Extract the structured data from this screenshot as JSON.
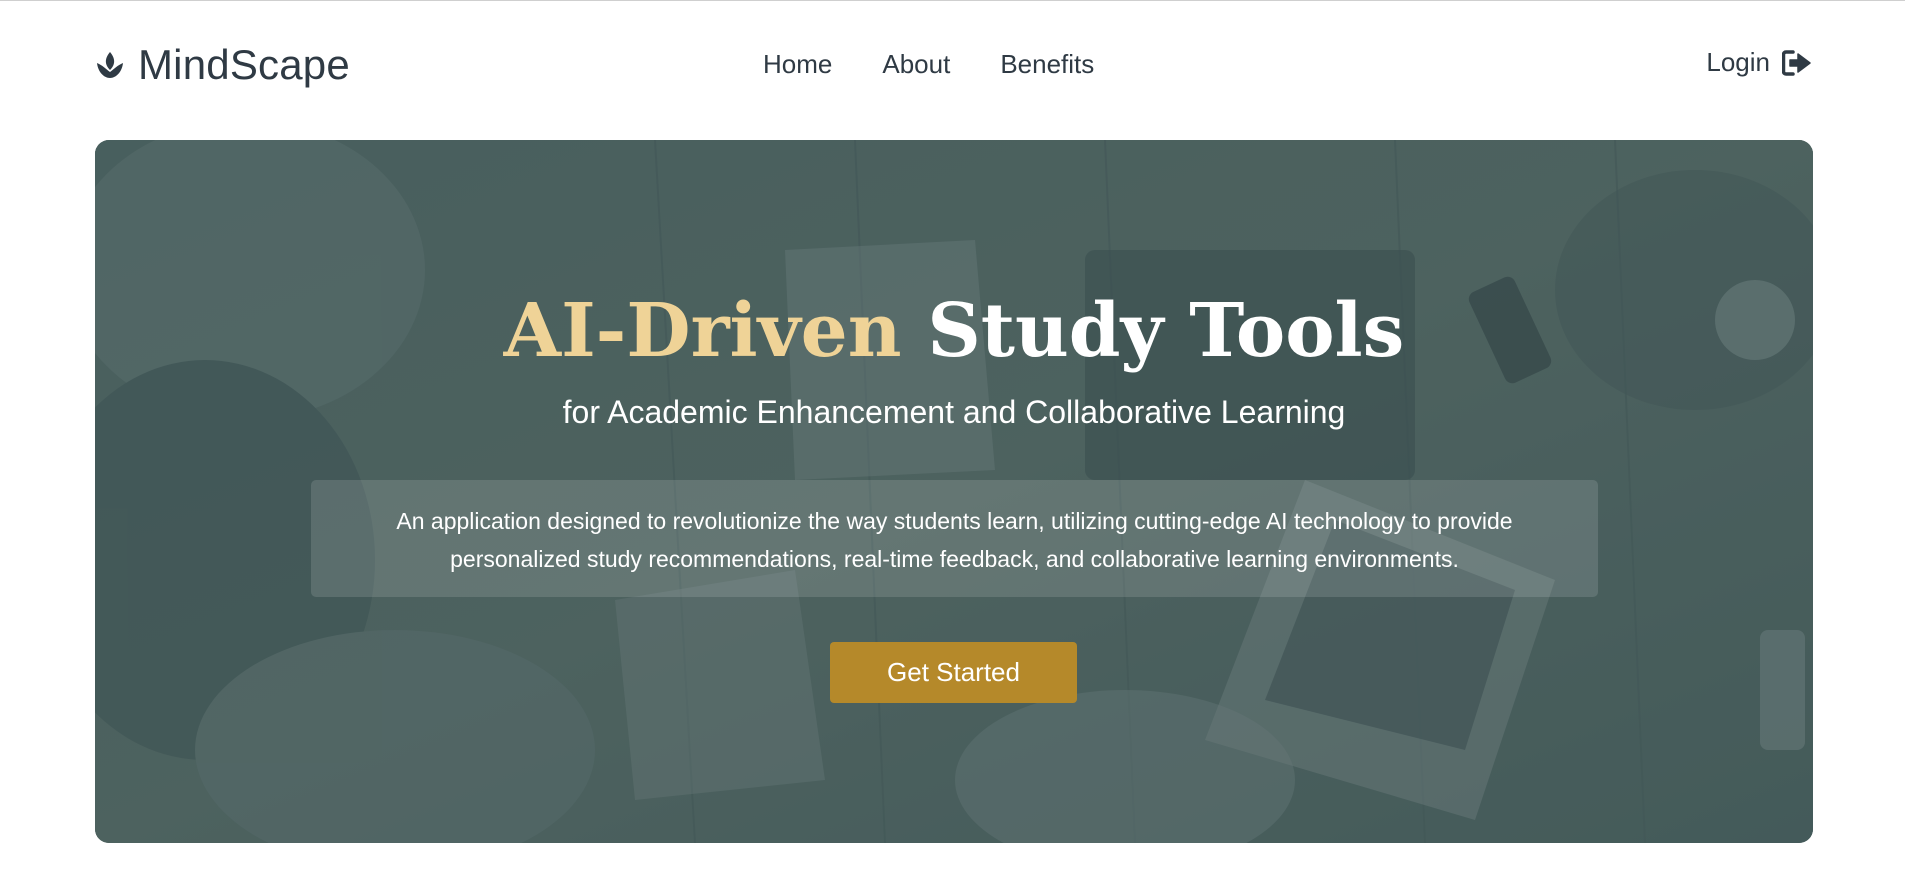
{
  "header": {
    "brand_name": "MindScape",
    "brand_icon": "lotus-icon",
    "nav": [
      {
        "label": "Home"
      },
      {
        "label": "About"
      },
      {
        "label": "Benefits"
      }
    ],
    "login_label": "Login",
    "login_icon": "sign-in-icon"
  },
  "hero": {
    "title_accent": "AI-Driven",
    "title_rest": "Study Tools",
    "subtitle": "for Academic Enhancement and Collaborative Learning",
    "description": "An application designed to revolutionize the way students learn, utilizing cutting-edge AI technology to provide personalized study recommendations, real-time feedback, and collaborative learning environments.",
    "cta_label": "Get Started"
  },
  "colors": {
    "accent_gold": "#efd397",
    "button_gold": "#b5892a",
    "text_dark": "#2f3a44",
    "hero_tint": "#4a5e5d"
  }
}
